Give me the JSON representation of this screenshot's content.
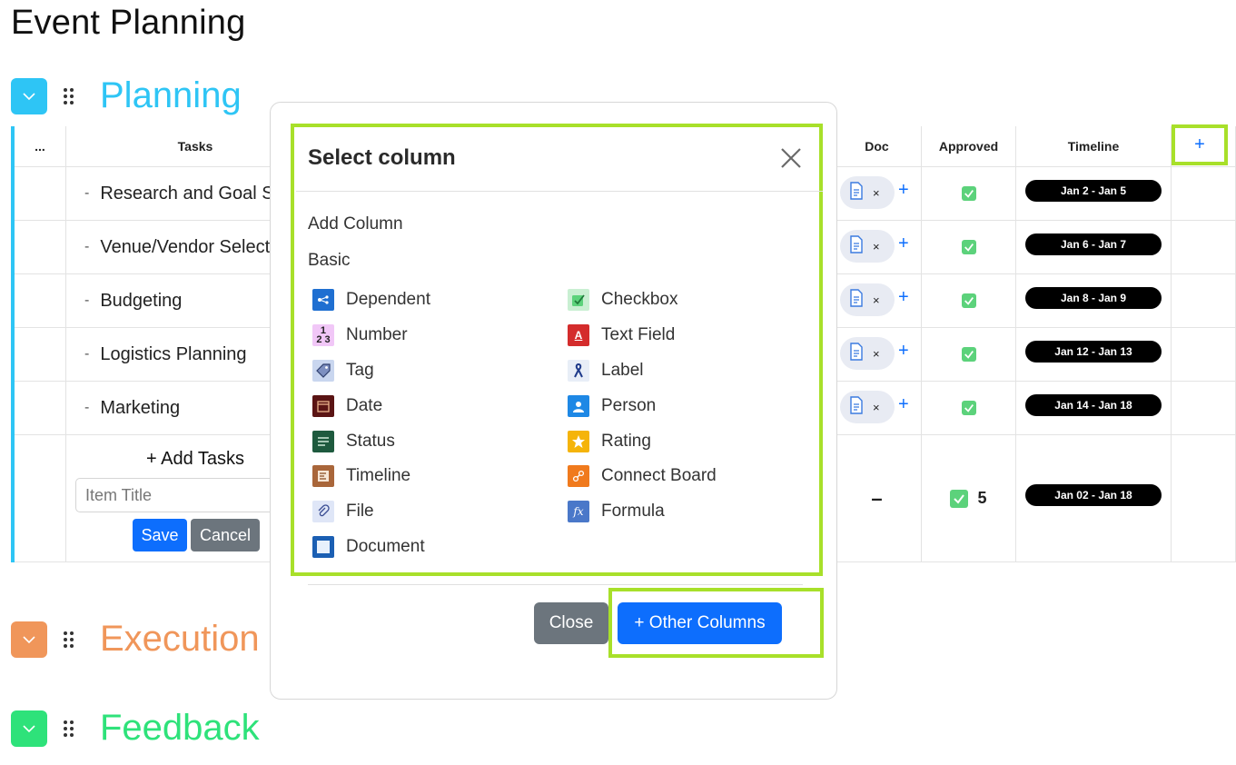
{
  "page": {
    "title": "Event Planning"
  },
  "groups": [
    {
      "name": "Planning",
      "color": "#2ec5f5"
    },
    {
      "name": "Execution",
      "color": "#f0965a"
    },
    {
      "name": "Feedback",
      "color": "#2ee27a"
    }
  ],
  "table": {
    "headers": {
      "menu": "...",
      "tasks": "Tasks",
      "doc": "Doc",
      "approved": "Approved",
      "timeline": "Timeline",
      "add": "+"
    },
    "rows": [
      {
        "task": "Research and Goal Setting",
        "timeline": "Jan 2 - Jan 5"
      },
      {
        "task": "Venue/Vendor Selection",
        "timeline": "Jan 6 - Jan 7"
      },
      {
        "task": "Budgeting",
        "timeline": "Jan 8 - Jan 9"
      },
      {
        "task": "Logistics Planning",
        "timeline": "Jan 12 - Jan 13"
      },
      {
        "task": "Marketing",
        "timeline": "Jan 14 - Jan 18"
      }
    ],
    "row_dash": "-",
    "doc_remove": "×",
    "doc_add": "+",
    "summary": {
      "doc": "–",
      "approved_count": "5",
      "timeline": "Jan 02 - Jan 18"
    },
    "add_tasks_label": "+ Add Tasks",
    "item_title_placeholder": "Item Title",
    "save_label": "Save",
    "cancel_label": "Cancel"
  },
  "modal": {
    "title": "Select column",
    "add_column_label": "Add Column",
    "basic_label": "Basic",
    "left_options": [
      {
        "label": "Dependent",
        "icon": "dependent-icon"
      },
      {
        "label": "Number",
        "icon": "number-icon"
      },
      {
        "label": "Tag",
        "icon": "tag-icon"
      },
      {
        "label": "Date",
        "icon": "date-icon"
      },
      {
        "label": "Status",
        "icon": "status-icon"
      },
      {
        "label": "Timeline",
        "icon": "timeline-icon"
      },
      {
        "label": "File",
        "icon": "file-icon"
      },
      {
        "label": "Document",
        "icon": "document-icon"
      }
    ],
    "right_options": [
      {
        "label": "Checkbox",
        "icon": "checkbox-icon"
      },
      {
        "label": "Text Field",
        "icon": "text-field-icon"
      },
      {
        "label": "Label",
        "icon": "label-icon"
      },
      {
        "label": "Person",
        "icon": "person-icon"
      },
      {
        "label": "Rating",
        "icon": "rating-icon"
      },
      {
        "label": "Connect Board",
        "icon": "connect-board-icon"
      },
      {
        "label": "Formula",
        "icon": "formula-icon"
      }
    ],
    "close_label": "Close",
    "other_columns_label": "+ Other Columns"
  },
  "colors": {
    "accent": "#0d6efd",
    "highlight": "#a8e02a",
    "approved": "#5cd27b",
    "secondary": "#6c757d"
  }
}
